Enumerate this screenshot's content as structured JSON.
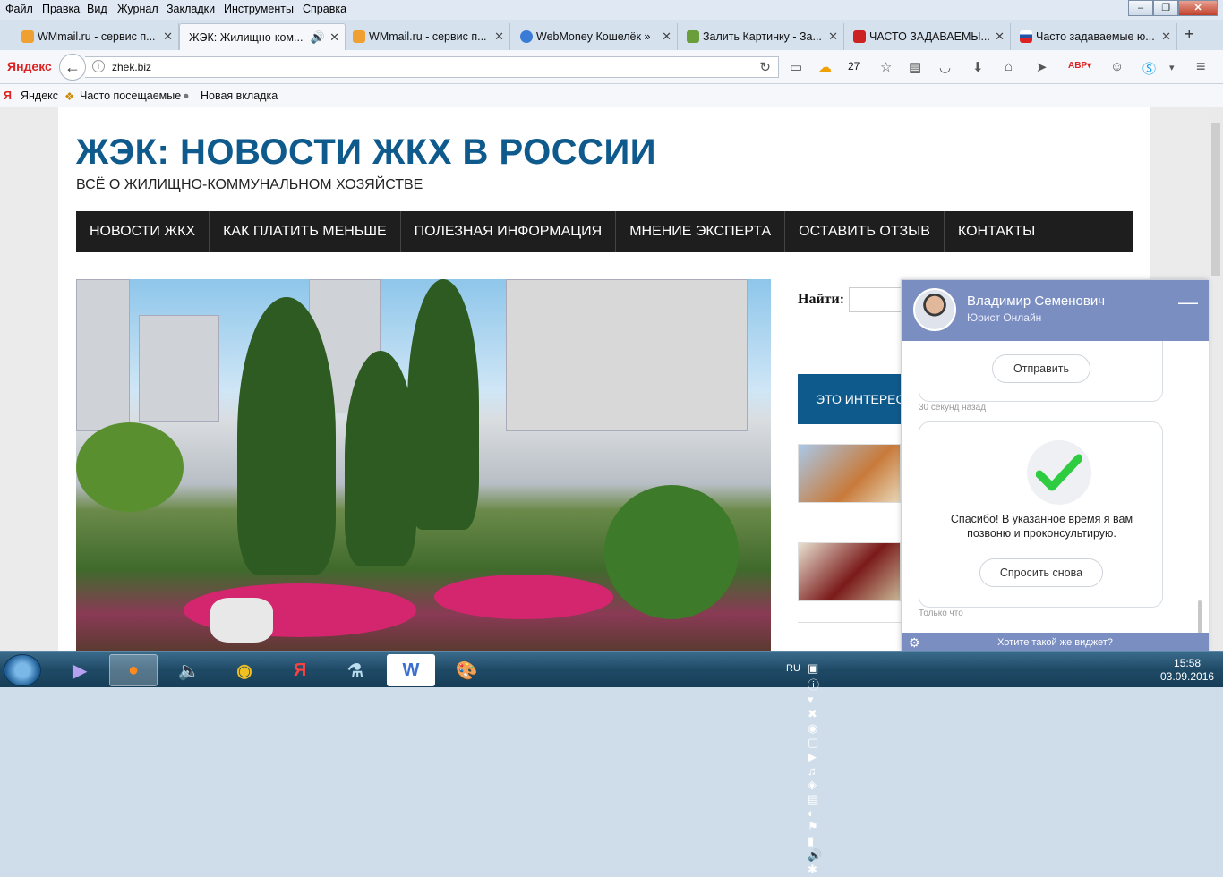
{
  "menubar": {
    "items": [
      "Файл",
      "Правка",
      "Вид",
      "Журнал",
      "Закладки",
      "Инструменты",
      "Справка"
    ]
  },
  "tabs": [
    {
      "title": "WMmail.ru - сервис п...",
      "color": "#f0a030"
    },
    {
      "title": "ЖЭК: Жилищно-ком...",
      "color": "#dde"
    },
    {
      "title": "WMmail.ru - сервис п...",
      "color": "#f0a030"
    },
    {
      "title": "WebMoney Кошелёк »",
      "color": "#3a7bd5"
    },
    {
      "title": "Залить Картинку - За...",
      "color": "#6a9e3a"
    },
    {
      "title": "ЧАСТО ЗАДАВАЕМЫ...",
      "color": "#c22"
    },
    {
      "title": "Часто задаваемые ю...",
      "color": "#2255aa"
    }
  ],
  "nav": {
    "logo": "Яндекс",
    "url": "zhek.biz",
    "weather": "27",
    "icons": [
      "back-icon",
      "info-icon",
      "reload-icon",
      "weather-icon",
      "star-icon",
      "reading-list-icon",
      "pocket-icon",
      "download-icon",
      "home-icon",
      "send-icon",
      "adblock-icon",
      "chat-icon",
      "skype-icon",
      "menu-icon"
    ]
  },
  "bookmarks": {
    "items": [
      "Яндекс",
      "Часто посещаемые",
      "Новая вкладка"
    ]
  },
  "site": {
    "title": "ЖЭК: НОВОСТИ ЖКХ В РОССИИ",
    "subtitle": "ВСЁ О ЖИЛИЩНО-КОММУНАЛЬНОМ ХОЗЯЙСТВЕ",
    "menu": [
      "НОВОСТИ ЖКХ",
      "КАК ПЛАТИТЬ МЕНЬШЕ",
      "ПОЛЕЗНАЯ ИНФОРМАЦИЯ",
      "МНЕНИЕ ЭКСПЕРТА",
      "ОСТАВИТЬ ОТЗЫВ",
      "КОНТАКТЫ"
    ],
    "search_label": "Найти:",
    "interesting": "ЭТО ИНТЕРЕС",
    "colors": {
      "title": "#0f5a8c",
      "menu_bg": "#1e1e1e"
    }
  },
  "chat": {
    "name": "Владимир Семенович",
    "role": "Юрист Онлайн",
    "send_button": "Отправить",
    "ts1": "30 секунд назад",
    "thanks": "Спасибо! В указанное время я вам позвоню и проконсультирую.",
    "ask_again": "Спросить снова",
    "ts2": "Только что",
    "footer": "Хотите такой же виджет?",
    "colors": {
      "header": "#7a8ec1",
      "check": "#2ecc40"
    }
  },
  "taskbar": {
    "lang": "RU",
    "time": "15:58",
    "date": "03.09.2016",
    "apps": [
      "media-icon",
      "firefox-icon",
      "audio-icon",
      "chrome-icon",
      "yandex-browser-icon",
      "app-icon",
      "word-icon",
      "paint-icon"
    ]
  }
}
